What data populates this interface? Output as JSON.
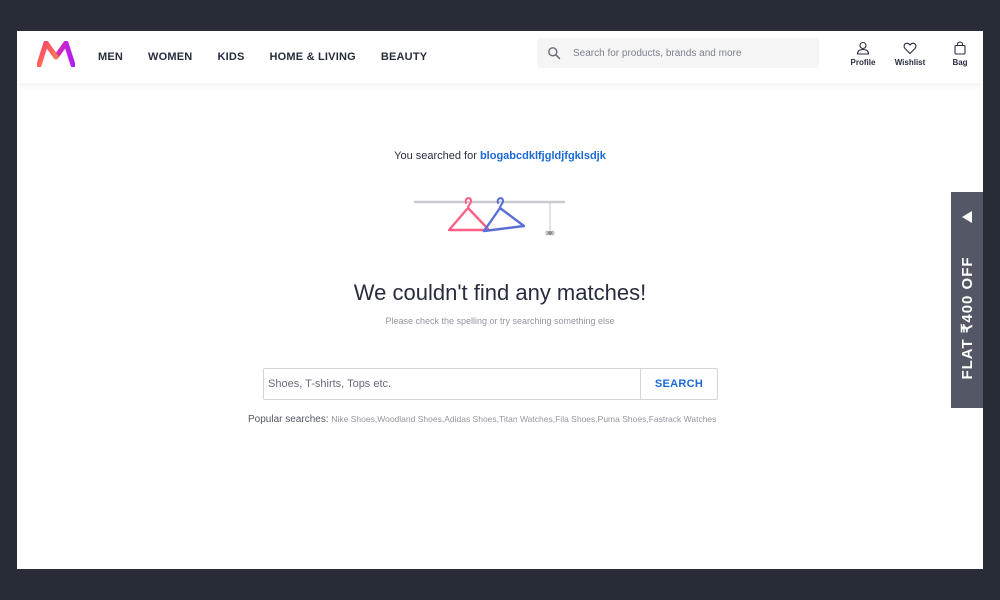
{
  "header": {
    "logo_icon": "myntra-logo",
    "nav": [
      "MEN",
      "WOMEN",
      "KIDS",
      "HOME & LIVING",
      "BEAUTY"
    ],
    "search_placeholder": "Search for products, brands and more",
    "actions": {
      "profile": "Profile",
      "wishlist": "Wishlist",
      "bag": "Bag"
    }
  },
  "results": {
    "searched_prefix": "You searched for",
    "search_term": "blogabcdklfjgldjfgklsdjk",
    "illustration_icon": "hangers-icon",
    "headline": "We couldn't find any matches!",
    "subline": "Please check the spelling or try searching something else",
    "search_placeholder": "Shoes, T-shirts, Tops etc.",
    "search_button": "SEARCH",
    "popular_label": "Popular searches:",
    "popular_items": [
      "Nike Shoes",
      "Woodland Shoes",
      "Adidas Shoes",
      "Titan Watches",
      "Fila Shoes",
      "Puma Shoes",
      "Fastrack Watches"
    ]
  },
  "promo_tab": {
    "label": "FLAT ₹400 OFF"
  },
  "colors": {
    "accent_blue": "#1b69d8",
    "text_dark": "#282c3f",
    "muted": "#94969f",
    "side_tab_bg": "#535766",
    "outer_bg": "#282c36",
    "logo_pink": "#ff3f6c",
    "logo_orange": "#ff9a3c",
    "logo_purple": "#b01df2"
  }
}
